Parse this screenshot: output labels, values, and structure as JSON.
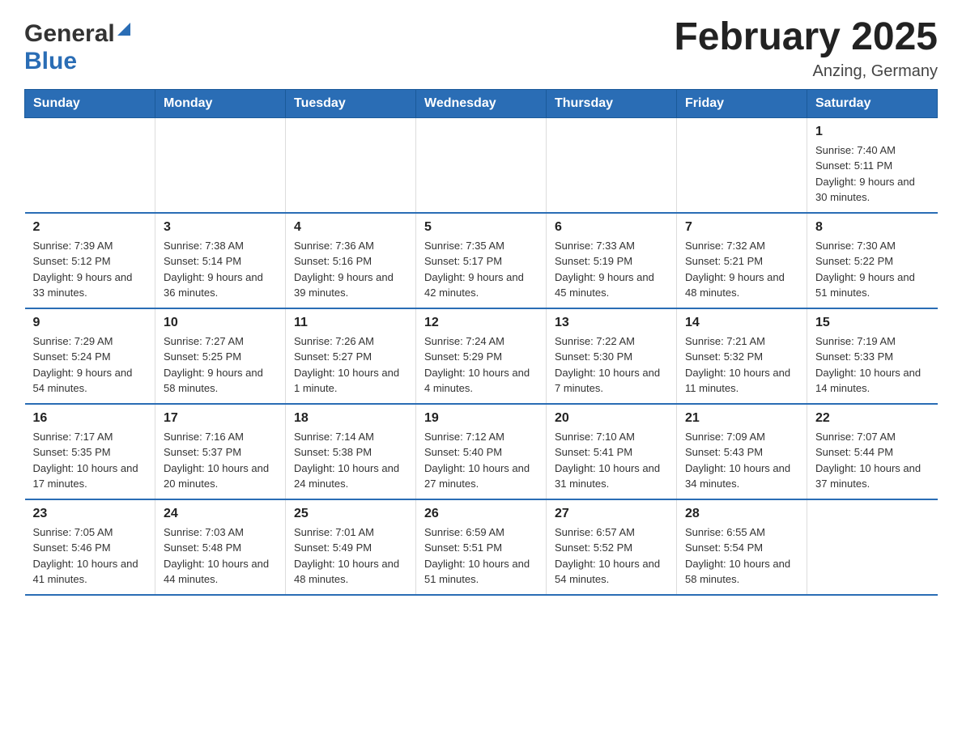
{
  "header": {
    "title": "February 2025",
    "subtitle": "Anzing, Germany",
    "logo_general": "General",
    "logo_blue": "Blue"
  },
  "weekdays": [
    "Sunday",
    "Monday",
    "Tuesday",
    "Wednesday",
    "Thursday",
    "Friday",
    "Saturday"
  ],
  "weeks": [
    [
      {
        "day": "",
        "sunrise": "",
        "sunset": "",
        "daylight": ""
      },
      {
        "day": "",
        "sunrise": "",
        "sunset": "",
        "daylight": ""
      },
      {
        "day": "",
        "sunrise": "",
        "sunset": "",
        "daylight": ""
      },
      {
        "day": "",
        "sunrise": "",
        "sunset": "",
        "daylight": ""
      },
      {
        "day": "",
        "sunrise": "",
        "sunset": "",
        "daylight": ""
      },
      {
        "day": "",
        "sunrise": "",
        "sunset": "",
        "daylight": ""
      },
      {
        "day": "1",
        "sunrise": "Sunrise: 7:40 AM",
        "sunset": "Sunset: 5:11 PM",
        "daylight": "Daylight: 9 hours and 30 minutes."
      }
    ],
    [
      {
        "day": "2",
        "sunrise": "Sunrise: 7:39 AM",
        "sunset": "Sunset: 5:12 PM",
        "daylight": "Daylight: 9 hours and 33 minutes."
      },
      {
        "day": "3",
        "sunrise": "Sunrise: 7:38 AM",
        "sunset": "Sunset: 5:14 PM",
        "daylight": "Daylight: 9 hours and 36 minutes."
      },
      {
        "day": "4",
        "sunrise": "Sunrise: 7:36 AM",
        "sunset": "Sunset: 5:16 PM",
        "daylight": "Daylight: 9 hours and 39 minutes."
      },
      {
        "day": "5",
        "sunrise": "Sunrise: 7:35 AM",
        "sunset": "Sunset: 5:17 PM",
        "daylight": "Daylight: 9 hours and 42 minutes."
      },
      {
        "day": "6",
        "sunrise": "Sunrise: 7:33 AM",
        "sunset": "Sunset: 5:19 PM",
        "daylight": "Daylight: 9 hours and 45 minutes."
      },
      {
        "day": "7",
        "sunrise": "Sunrise: 7:32 AM",
        "sunset": "Sunset: 5:21 PM",
        "daylight": "Daylight: 9 hours and 48 minutes."
      },
      {
        "day": "8",
        "sunrise": "Sunrise: 7:30 AM",
        "sunset": "Sunset: 5:22 PM",
        "daylight": "Daylight: 9 hours and 51 minutes."
      }
    ],
    [
      {
        "day": "9",
        "sunrise": "Sunrise: 7:29 AM",
        "sunset": "Sunset: 5:24 PM",
        "daylight": "Daylight: 9 hours and 54 minutes."
      },
      {
        "day": "10",
        "sunrise": "Sunrise: 7:27 AM",
        "sunset": "Sunset: 5:25 PM",
        "daylight": "Daylight: 9 hours and 58 minutes."
      },
      {
        "day": "11",
        "sunrise": "Sunrise: 7:26 AM",
        "sunset": "Sunset: 5:27 PM",
        "daylight": "Daylight: 10 hours and 1 minute."
      },
      {
        "day": "12",
        "sunrise": "Sunrise: 7:24 AM",
        "sunset": "Sunset: 5:29 PM",
        "daylight": "Daylight: 10 hours and 4 minutes."
      },
      {
        "day": "13",
        "sunrise": "Sunrise: 7:22 AM",
        "sunset": "Sunset: 5:30 PM",
        "daylight": "Daylight: 10 hours and 7 minutes."
      },
      {
        "day": "14",
        "sunrise": "Sunrise: 7:21 AM",
        "sunset": "Sunset: 5:32 PM",
        "daylight": "Daylight: 10 hours and 11 minutes."
      },
      {
        "day": "15",
        "sunrise": "Sunrise: 7:19 AM",
        "sunset": "Sunset: 5:33 PM",
        "daylight": "Daylight: 10 hours and 14 minutes."
      }
    ],
    [
      {
        "day": "16",
        "sunrise": "Sunrise: 7:17 AM",
        "sunset": "Sunset: 5:35 PM",
        "daylight": "Daylight: 10 hours and 17 minutes."
      },
      {
        "day": "17",
        "sunrise": "Sunrise: 7:16 AM",
        "sunset": "Sunset: 5:37 PM",
        "daylight": "Daylight: 10 hours and 20 minutes."
      },
      {
        "day": "18",
        "sunrise": "Sunrise: 7:14 AM",
        "sunset": "Sunset: 5:38 PM",
        "daylight": "Daylight: 10 hours and 24 minutes."
      },
      {
        "day": "19",
        "sunrise": "Sunrise: 7:12 AM",
        "sunset": "Sunset: 5:40 PM",
        "daylight": "Daylight: 10 hours and 27 minutes."
      },
      {
        "day": "20",
        "sunrise": "Sunrise: 7:10 AM",
        "sunset": "Sunset: 5:41 PM",
        "daylight": "Daylight: 10 hours and 31 minutes."
      },
      {
        "day": "21",
        "sunrise": "Sunrise: 7:09 AM",
        "sunset": "Sunset: 5:43 PM",
        "daylight": "Daylight: 10 hours and 34 minutes."
      },
      {
        "day": "22",
        "sunrise": "Sunrise: 7:07 AM",
        "sunset": "Sunset: 5:44 PM",
        "daylight": "Daylight: 10 hours and 37 minutes."
      }
    ],
    [
      {
        "day": "23",
        "sunrise": "Sunrise: 7:05 AM",
        "sunset": "Sunset: 5:46 PM",
        "daylight": "Daylight: 10 hours and 41 minutes."
      },
      {
        "day": "24",
        "sunrise": "Sunrise: 7:03 AM",
        "sunset": "Sunset: 5:48 PM",
        "daylight": "Daylight: 10 hours and 44 minutes."
      },
      {
        "day": "25",
        "sunrise": "Sunrise: 7:01 AM",
        "sunset": "Sunset: 5:49 PM",
        "daylight": "Daylight: 10 hours and 48 minutes."
      },
      {
        "day": "26",
        "sunrise": "Sunrise: 6:59 AM",
        "sunset": "Sunset: 5:51 PM",
        "daylight": "Daylight: 10 hours and 51 minutes."
      },
      {
        "day": "27",
        "sunrise": "Sunrise: 6:57 AM",
        "sunset": "Sunset: 5:52 PM",
        "daylight": "Daylight: 10 hours and 54 minutes."
      },
      {
        "day": "28",
        "sunrise": "Sunrise: 6:55 AM",
        "sunset": "Sunset: 5:54 PM",
        "daylight": "Daylight: 10 hours and 58 minutes."
      },
      {
        "day": "",
        "sunrise": "",
        "sunset": "",
        "daylight": ""
      }
    ]
  ]
}
